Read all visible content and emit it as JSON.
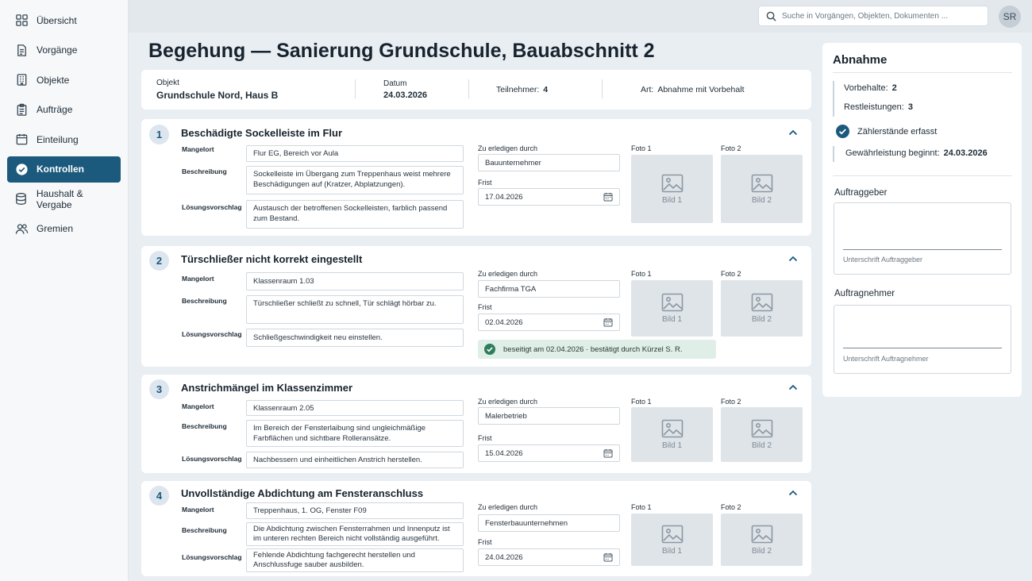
{
  "sidebar": {
    "items": [
      {
        "label": "Übersicht",
        "icon": "grid-icon",
        "active": false
      },
      {
        "label": "Vorgänge",
        "icon": "document-icon",
        "active": false
      },
      {
        "label": "Objekte",
        "icon": "building-icon",
        "active": false
      },
      {
        "label": "Aufträge",
        "icon": "clipboard-icon",
        "active": false
      },
      {
        "label": "Einteilung",
        "icon": "calendar-icon",
        "active": false
      },
      {
        "label": "Kontrollen",
        "icon": "check-circle-icon",
        "active": true
      },
      {
        "label": "Haushalt & Vergabe",
        "icon": "database-icon",
        "active": false
      },
      {
        "label": "Gremien",
        "icon": "users-icon",
        "active": false
      }
    ]
  },
  "topbar": {
    "search_placeholder": "Suche in Vorgängen, Objekten, Dokumenten ...",
    "avatar_initials": "SR"
  },
  "page": {
    "title": "Begehung — Sanierung Grundschule, Bauabschnitt 2"
  },
  "meta": {
    "objekt_label": "Objekt",
    "objekt_value": "Grundschule Nord, Haus B",
    "datum_label": "Datum",
    "datum_value": "24.03.2026",
    "teilnehmer_label": "Teilnehmer:",
    "teilnehmer_value": "4",
    "art_label": "Art:",
    "art_value": "Abnahme mit Vorbehalt"
  },
  "labels": {
    "mangelort": "Mangelort",
    "beschreibung": "Beschreibung",
    "loesungsvorschlag": "Lösungsvorschlag",
    "zu_erledigen": "Zu erledigen durch",
    "frist": "Frist",
    "foto1": "Foto 1",
    "foto2": "Foto 2",
    "bild1": "Bild 1",
    "bild2": "Bild 2"
  },
  "defects": [
    {
      "number": "1",
      "title": "Beschädigte Sockelleiste im Flur",
      "mangelort": "Flur EG, Bereich vor Aula",
      "beschreibung": "Sockelleiste im Übergang zum Treppenhaus weist mehrere Beschädigungen auf (Kratzer, Abplatzungen).",
      "loesung": "Austausch der betroffenen Sockelleisten, farblich passend zum Bestand.",
      "zu_erledigen": "Bauunternehmer",
      "frist": "17.04.2026"
    },
    {
      "number": "2",
      "title": "Türschließer nicht korrekt eingestellt",
      "mangelort": "Klassenraum 1.03",
      "beschreibung": "Türschließer schließt zu schnell, Tür schlägt hörbar zu.",
      "loesung": "Schließgeschwindigkeit neu einstellen.",
      "zu_erledigen": "Fachfirma TGA",
      "frist": "02.04.2026",
      "status": "beseitigt am 02.04.2026 · bestätigt durch Kürzel S. R."
    },
    {
      "number": "3",
      "title": "Anstrichmängel im Klassenzimmer",
      "mangelort": "Klassenraum 2.05",
      "beschreibung": "Im Bereich der Fensterlaibung sind ungleichmäßige Farbflächen und sichtbare Rolleransätze.",
      "loesung": "Nachbessern und einheitlichen Anstrich herstellen.",
      "zu_erledigen": "Malerbetrieb",
      "frist": "15.04.2026"
    },
    {
      "number": "4",
      "title": "Unvollständige Abdichtung am Fensteranschluss",
      "mangelort": "Treppenhaus, 1. OG, Fenster F09",
      "beschreibung": "Die Abdichtung zwischen Fensterrahmen und Innenputz ist im unteren rechten Bereich nicht vollständig ausgeführt.",
      "loesung": "Fehlende Abdichtung fachgerecht herstellen und Anschlussfuge sauber ausbilden.",
      "zu_erledigen": "Fensterbauunternehmen",
      "frist": "24.04.2026"
    }
  ],
  "abnahme": {
    "title": "Abnahme",
    "vorbehalte_label": "Vorbehalte:",
    "vorbehalte_value": "2",
    "restleistungen_label": "Restleistungen:",
    "restleistungen_value": "3",
    "zaehler_label": "Zählerstände erfasst",
    "gewaehrleistung_label": "Gewährleistung beginnt:",
    "gewaehrleistung_value": "24.03.2026",
    "auftraggeber_label": "Auftraggeber",
    "auftraggeber_sig": "Unterschrift Auftraggeber",
    "auftragnehmer_label": "Auftragnehmer",
    "auftragnehmer_sig": "Unterschrift Auftragnehmer"
  },
  "colors": {
    "accent": "#1b5a7d",
    "success": "#2e7d5b",
    "background": "#e9eef3"
  }
}
